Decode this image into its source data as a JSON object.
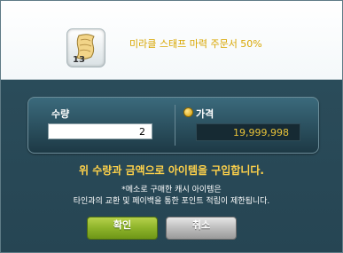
{
  "item": {
    "icon": "scroll-icon",
    "quantity_badge": "13",
    "name": "미라클 스태프 마력 주문서 50%"
  },
  "purchase": {
    "quantity_label": "수량",
    "quantity_value": "2",
    "price_label": "가격",
    "price_value": "19,999,998"
  },
  "messages": {
    "confirm": "위 수량과 금액으로 아이템을 구입합니다.",
    "notice_line1": "*메소로 구매한 캐시 아이템은",
    "notice_line2": "타인과의 교환 및 페이백을 통한 포인트 적립이 제한됩니다."
  },
  "buttons": {
    "ok": "확인",
    "cancel": "취소"
  },
  "colors": {
    "dialog_bg": "#2a4b59",
    "item_name": "#d8a600",
    "price_text": "#e7c23a",
    "confirm_text": "#ffd24a",
    "ok_button": "#8db32a",
    "cancel_button": "#bdbdbd"
  }
}
